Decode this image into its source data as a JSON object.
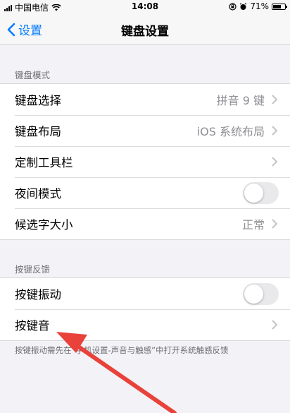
{
  "status_bar": {
    "carrier": "中国电信",
    "time": "14:08",
    "battery_text": "71%",
    "battery_level": 0.71
  },
  "nav": {
    "back_label": "设置",
    "title": "键盘设置"
  },
  "sections": [
    {
      "header": "键盘模式",
      "rows": [
        {
          "label": "键盘选择",
          "value": "拼音 9 键",
          "type": "chevron"
        },
        {
          "label": "键盘布局",
          "value": "iOS 系统布局",
          "type": "chevron"
        },
        {
          "label": "定制工具栏",
          "value": "",
          "type": "chevron"
        },
        {
          "label": "夜间模式",
          "value": "",
          "type": "toggle",
          "on": false
        },
        {
          "label": "候选字大小",
          "value": "正常",
          "type": "chevron"
        }
      ]
    },
    {
      "header": "按键反馈",
      "rows": [
        {
          "label": "按键振动",
          "value": "",
          "type": "toggle",
          "on": false
        },
        {
          "label": "按键音",
          "value": "",
          "type": "chevron"
        }
      ]
    }
  ],
  "footer_note": "按键振动需先在“手机设置-声音与触感”中打开系统触感反馈",
  "colors": {
    "accent": "#007aff",
    "annotation_arrow": "#e8423a"
  }
}
